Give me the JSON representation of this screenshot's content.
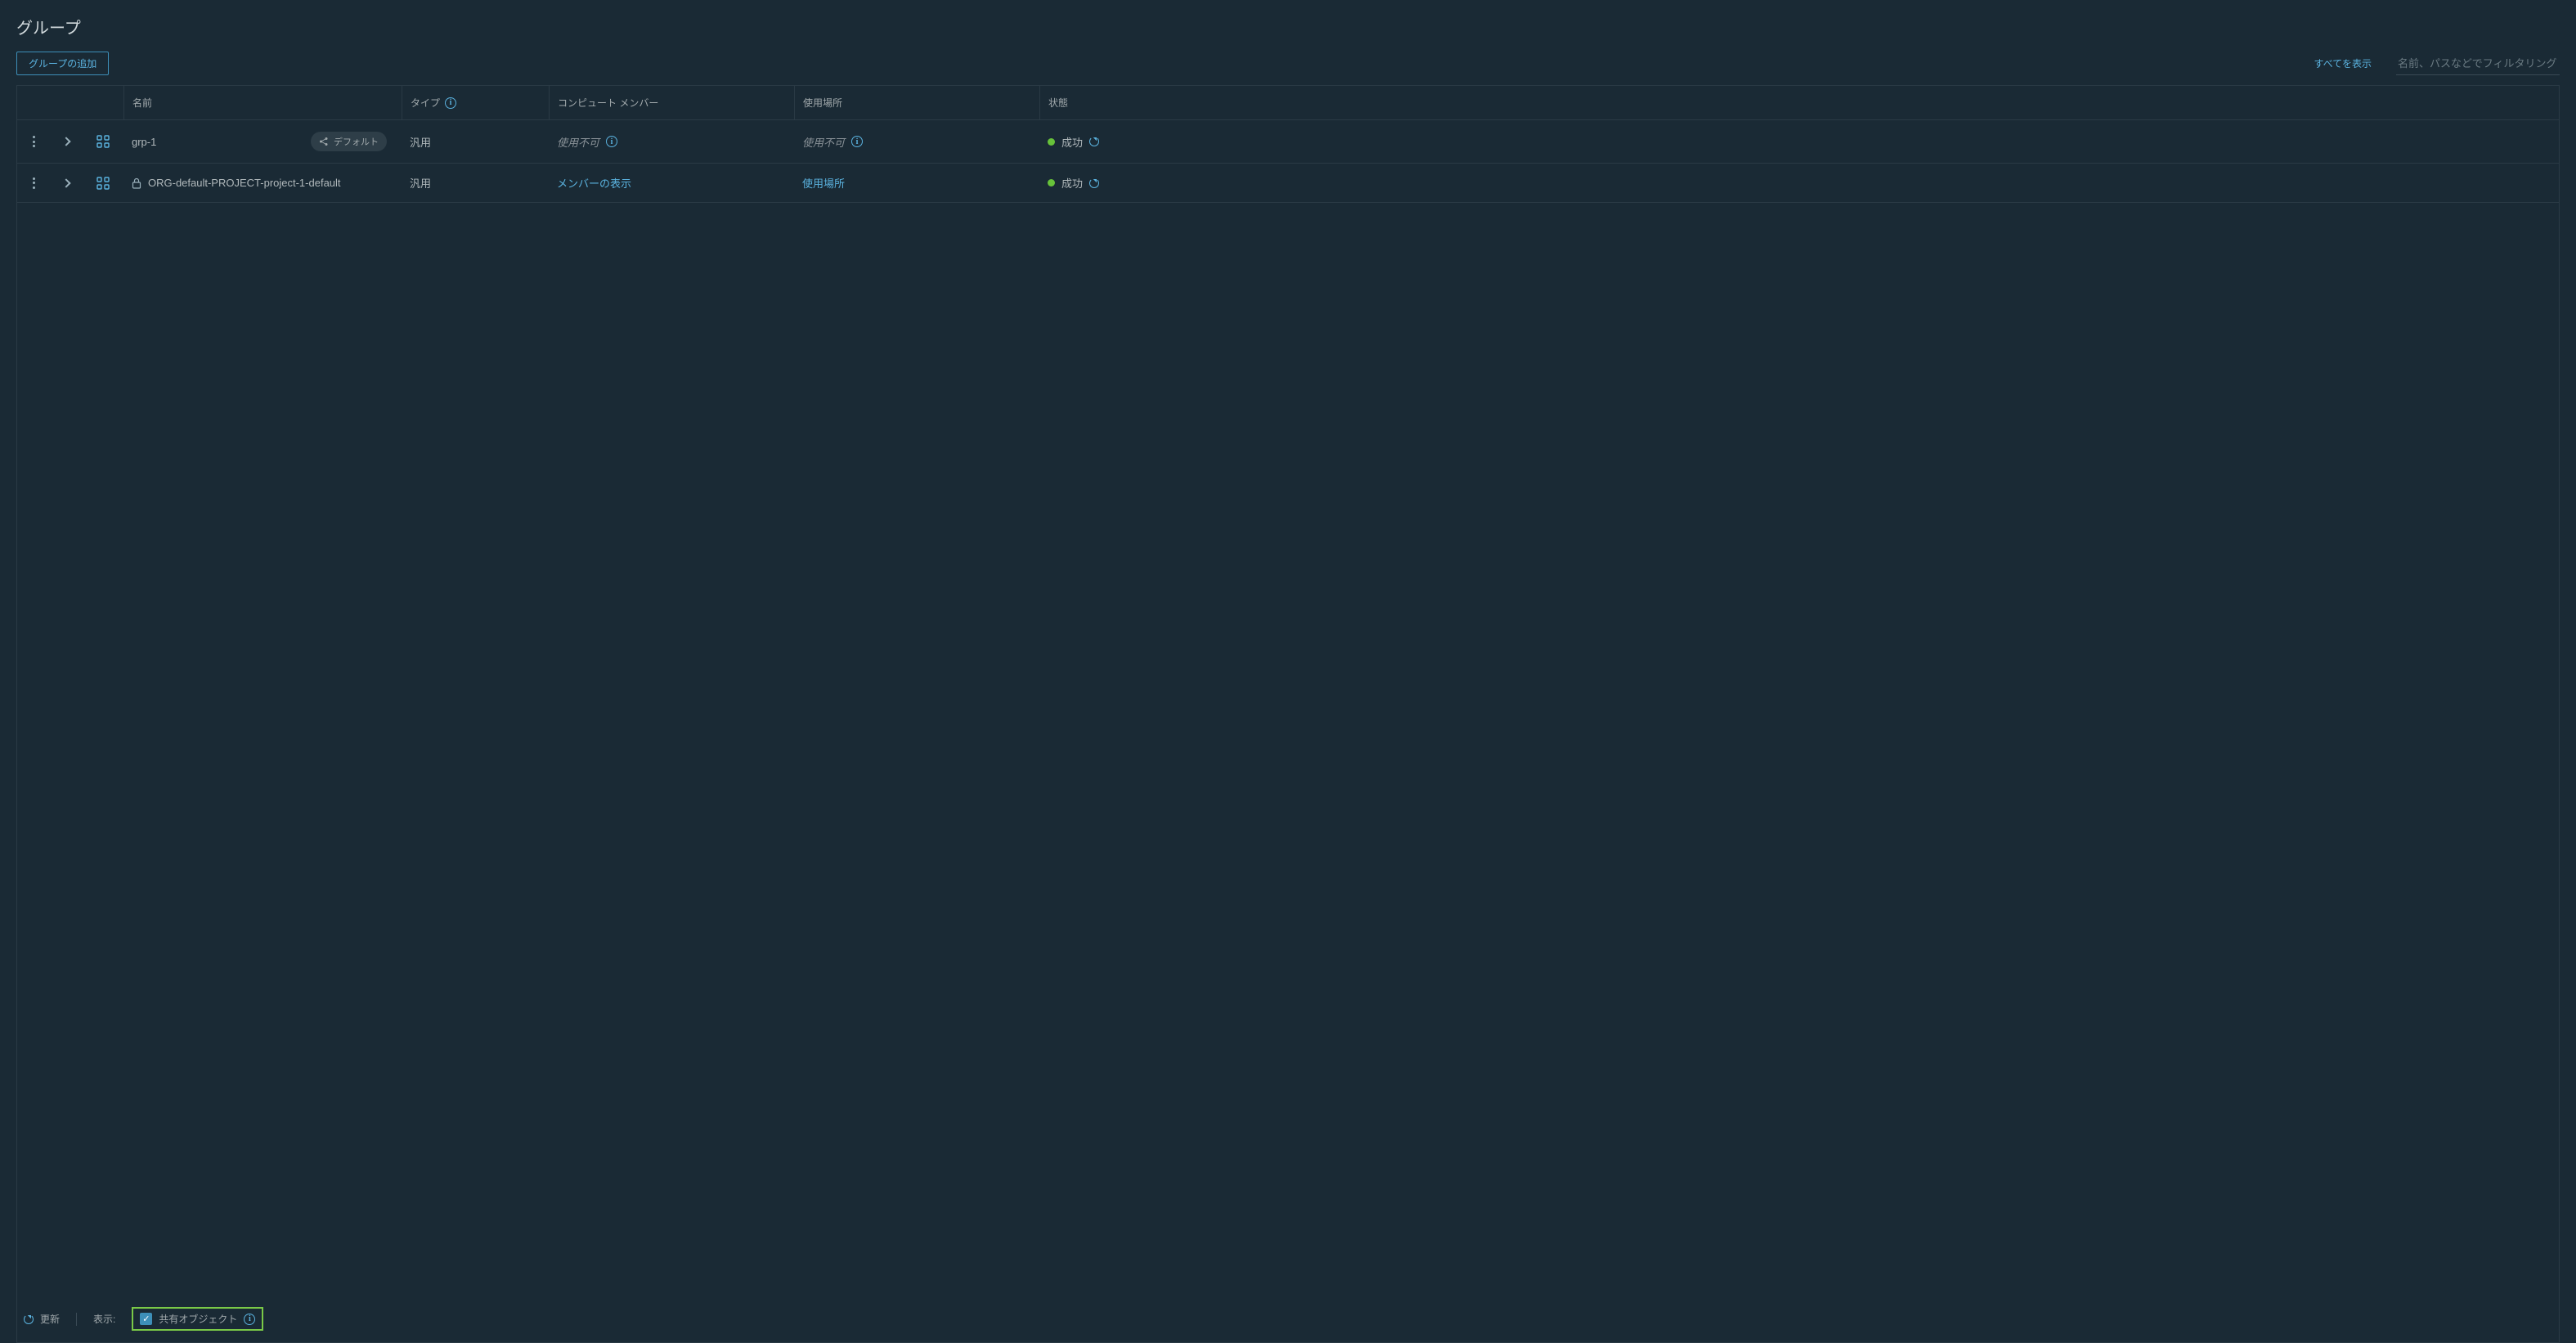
{
  "header": {
    "title": "グループ"
  },
  "toolbar": {
    "add_button": "グループの追加",
    "show_all": "すべてを表示",
    "filter_placeholder": "名前、パスなどでフィルタリング"
  },
  "columns": {
    "name": "名前",
    "type": "タイプ",
    "compute_member": "コンピュート メンバー",
    "where_used": "使用場所",
    "state": "状態"
  },
  "rows": [
    {
      "name": "grp-1",
      "locked": false,
      "badge": "デフォルト",
      "type": "汎用",
      "compute_member": "使用不可",
      "compute_member_is_link": false,
      "compute_member_info": true,
      "where_used": "使用不可",
      "where_used_is_link": false,
      "where_used_info": true,
      "state": "成功"
    },
    {
      "name": "ORG-default-PROJECT-project-1-default",
      "locked": true,
      "badge": "",
      "type": "汎用",
      "compute_member": "メンバーの表示",
      "compute_member_is_link": true,
      "compute_member_info": false,
      "where_used": "使用場所",
      "where_used_is_link": true,
      "where_used_info": false,
      "state": "成功"
    }
  ],
  "footer": {
    "refresh": "更新",
    "show_label": "表示:",
    "shared_objects": "共有オブジェクト"
  }
}
